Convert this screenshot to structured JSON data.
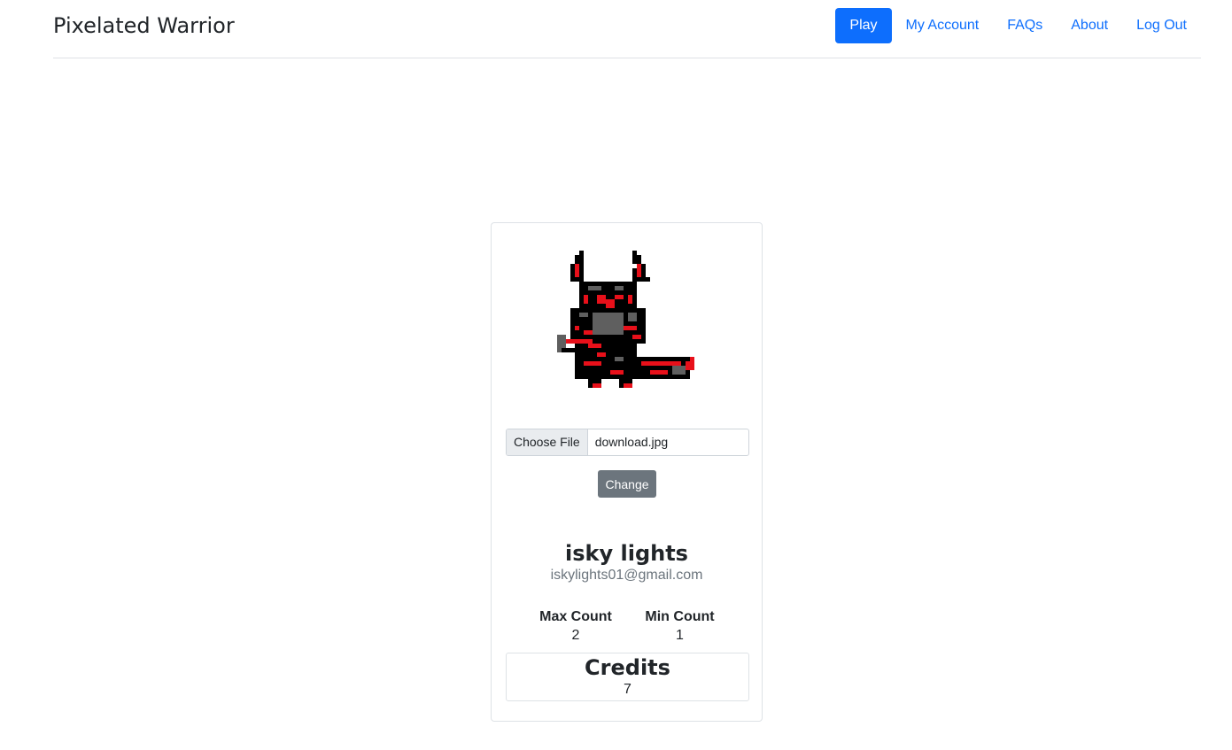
{
  "brand": "Pixelated Warrior",
  "nav": {
    "play": "Play",
    "my_account": "My Account",
    "faqs": "FAQs",
    "about": "About",
    "logout": "Log Out"
  },
  "profile": {
    "avatar_icon": "pixel-warrior-avatar-icon",
    "file_button": "Choose File",
    "file_name": "download.jpg",
    "change_label": "Change",
    "name": "isky lights",
    "email": "iskylights01@gmail.com",
    "max_count_label": "Max Count",
    "max_count_value": "2",
    "min_count_label": "Min Count",
    "min_count_value": "1",
    "credits_label": "Credits",
    "credits_value": "7"
  },
  "colors": {
    "primary": "#0d6efd",
    "secondary": "#6c757d",
    "avatar_red": "#e8101a",
    "avatar_gray": "#5f5f5f",
    "avatar_black": "#000000"
  }
}
